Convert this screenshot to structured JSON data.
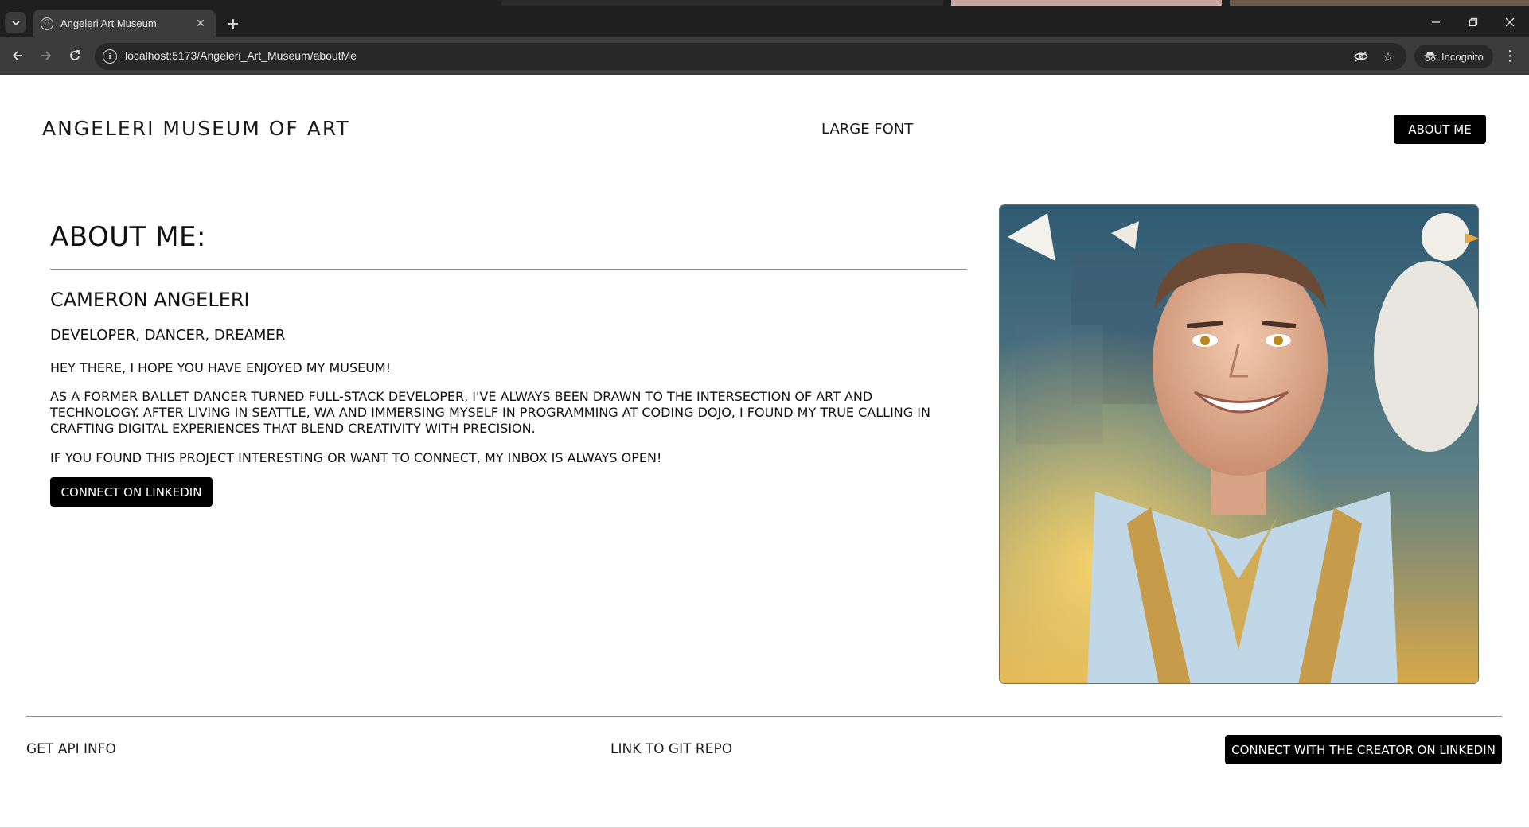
{
  "browser": {
    "tab_title": "Angeleri Art Museum",
    "tab_favicon_letter": "G",
    "url": "localhost:5173/Angeleri_Art_Museum/aboutMe",
    "incognito_label": "Incognito"
  },
  "header": {
    "site_title": "ANGELERI MUSEUM OF ART",
    "large_font_label": "LARGE FONT",
    "about_me_label": "ABOUT ME"
  },
  "about": {
    "heading": "ABOUT ME:",
    "name": "CAMERON ANGELERI",
    "tagline": "DEVELOPER, DANCER, DREAMER",
    "greeting": "HEY THERE, I HOPE YOU HAVE ENJOYED MY MUSEUM!",
    "bio": "AS A FORMER BALLET DANCER TURNED FULL-STACK DEVELOPER, I'VE ALWAYS BEEN DRAWN TO THE INTERSECTION OF ART AND TECHNOLOGY. AFTER LIVING IN SEATTLE, WA AND IMMERSING MYSELF IN PROGRAMMING AT CODING DOJO, I FOUND MY TRUE CALLING IN CRAFTING DIGITAL EXPERIENCES THAT BLEND CREATIVITY WITH PRECISION.",
    "connect_text": "IF YOU FOUND THIS PROJECT INTERESTING OR WANT TO CONNECT, MY INBOX IS ALWAYS OPEN!",
    "linkedin_button": "CONNECT ON LINKEDIN"
  },
  "footer": {
    "api_info": "GET API INFO",
    "git_repo": "LINK TO GIT REPO",
    "creator_linkedin": "CONNECT WITH THE CREATOR ON LINKEDIN"
  },
  "icons": {
    "tab_search": "chevron-down-icon",
    "tab_close": "close-icon",
    "new_tab": "plus-icon",
    "back": "arrow-left-icon",
    "forward": "arrow-right-icon",
    "reload": "reload-icon",
    "site_info": "info-icon",
    "eye_off": "eye-off-icon",
    "bookmark": "star-icon",
    "incognito": "incognito-icon",
    "menu": "more-vertical-icon"
  },
  "colors": {
    "chrome_dark": "#1f1f1f",
    "toolbar": "#3c3c3c",
    "button_bg": "#000000",
    "button_text": "#ffffff"
  }
}
